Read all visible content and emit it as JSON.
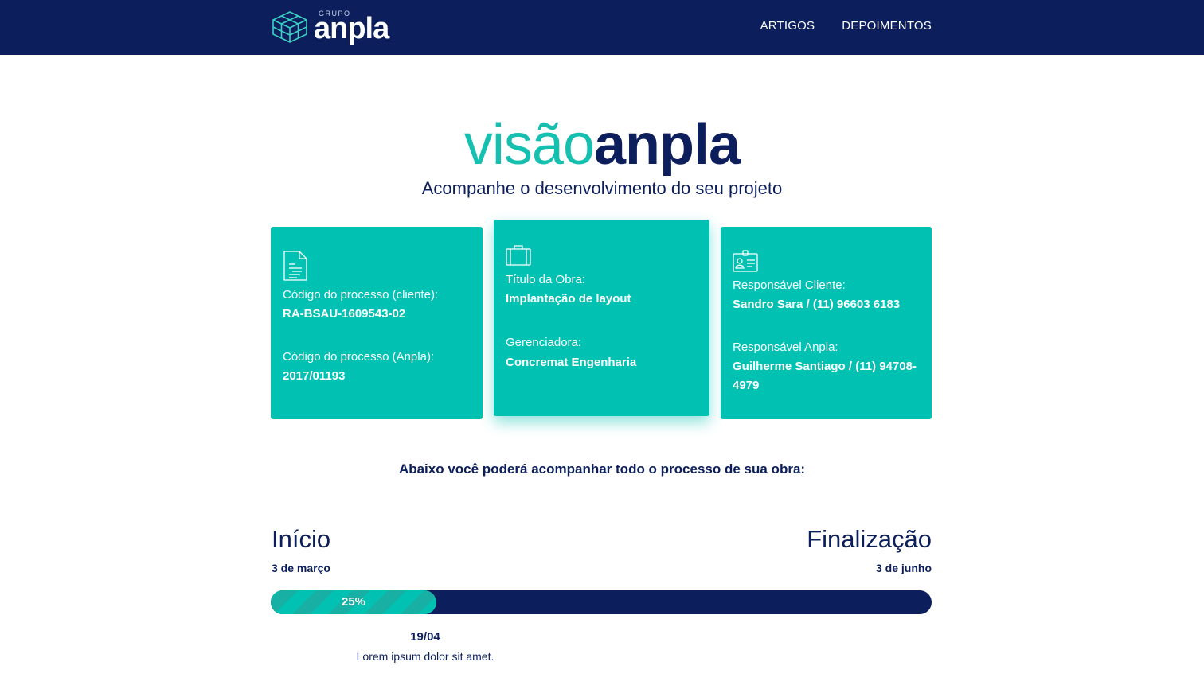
{
  "header": {
    "logo_small": "GRUPO",
    "logo_main": "anpla",
    "nav": [
      {
        "label": "ARTIGOS"
      },
      {
        "label": "DEPOIMENTOS"
      }
    ]
  },
  "hero": {
    "title_light": "visão",
    "title_bold": "anpla",
    "subtitle": "Acompanhe o desenvolvimento do seu projeto"
  },
  "cards": [
    {
      "icon": "document-icon",
      "fields": [
        {
          "label": "Código do processo (cliente):",
          "value": "RA-BSAU-1609543-02"
        },
        {
          "label": "Código do processo (Anpla):",
          "value": "2017/01193"
        }
      ]
    },
    {
      "icon": "briefcase-icon",
      "fields": [
        {
          "label": "Título da Obra:",
          "value": "Implantação de layout"
        },
        {
          "label": "Gerenciadora:",
          "value": "Concremat Engenharia"
        }
      ]
    },
    {
      "icon": "id-badge-icon",
      "fields": [
        {
          "label": "Responsável Cliente:",
          "value": "Sandro Sara / (11) 96603 6183"
        },
        {
          "label": "Responsável Anpla:",
          "value": "Guilherme Santiago / (11) 94708-4979"
        }
      ]
    }
  ],
  "intro": "Abaixo você poderá acompanhar todo o processo de sua obra:",
  "timeline": {
    "start_label": "Início",
    "start_date": "3 de março",
    "end_label": "Finalização",
    "end_date": "3 de junho",
    "progress_percent": 25,
    "progress_text": "25%",
    "milestone_date": "19/04",
    "milestone_desc": "Lorem ipsum dolor sit amet."
  },
  "colors": {
    "navy": "#0c1f5c",
    "teal": "#00c1b2",
    "teal_light": "#16c0b0"
  }
}
